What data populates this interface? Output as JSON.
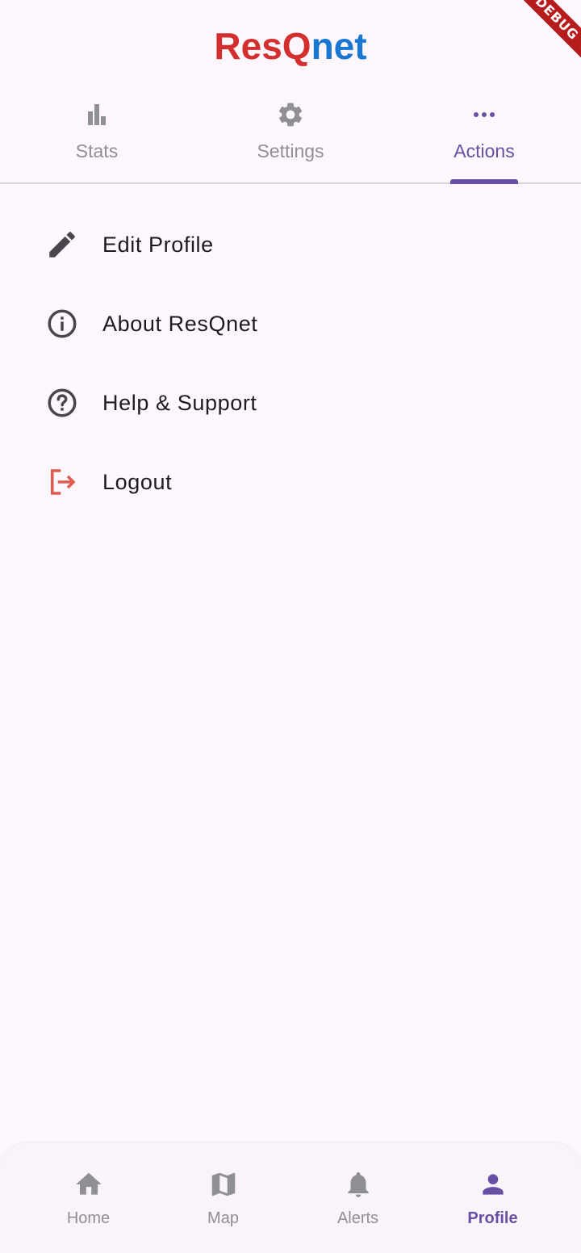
{
  "debug_banner": "DEBUG",
  "app": {
    "title_part1": "ResQ",
    "title_part2": "net",
    "color_part1": "#d32f2f",
    "color_part2": "#1976d2"
  },
  "tabs": [
    {
      "label": "Stats",
      "icon": "bar-chart-icon",
      "active": false
    },
    {
      "label": "Settings",
      "icon": "gear-icon",
      "active": false
    },
    {
      "label": "Actions",
      "icon": "more-horizontal-icon",
      "active": true
    }
  ],
  "actions": [
    {
      "label": "Edit Profile",
      "icon": "pencil-icon"
    },
    {
      "label": "About ResQnet",
      "icon": "info-icon"
    },
    {
      "label": "Help & Support",
      "icon": "help-circle-icon"
    },
    {
      "label": "Logout",
      "icon": "logout-icon",
      "color": "#e05a4e"
    }
  ],
  "bottom_nav": [
    {
      "label": "Home",
      "icon": "home-icon",
      "active": false
    },
    {
      "label": "Map",
      "icon": "map-icon",
      "active": false
    },
    {
      "label": "Alerts",
      "icon": "bell-icon",
      "active": false
    },
    {
      "label": "Profile",
      "icon": "person-icon",
      "active": true
    }
  ],
  "colors": {
    "accent": "#6750a4",
    "inactive": "#8f8f94",
    "background": "#fdf7fd"
  }
}
